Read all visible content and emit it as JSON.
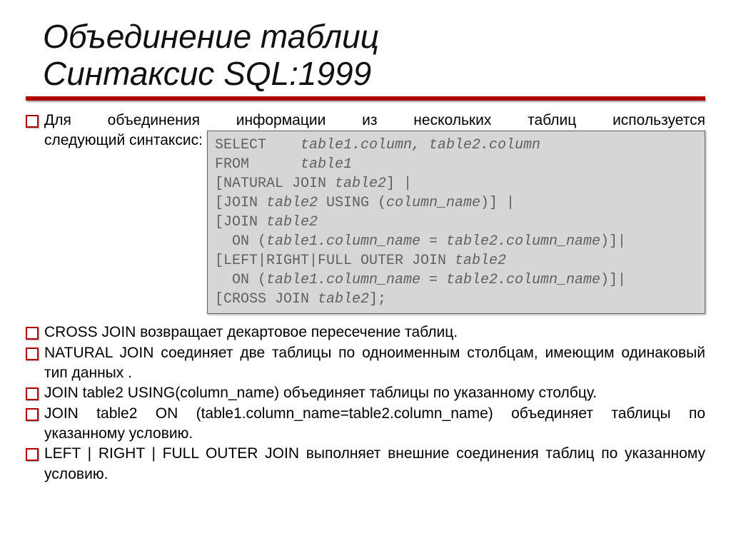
{
  "title_line1": "Объединение таблиц",
  "title_line2": "Синтаксис SQL:1999",
  "intro_top": "Для объединения информации из нескольких таблиц используется",
  "intro_bottom": "следующий синтаксис:",
  "code": {
    "l1a": "SELECT    ",
    "l1b": "table1.column, table2.column",
    "l2a": "FROM      ",
    "l2b": "table1",
    "l3a": "[NATURAL JOIN ",
    "l3b": "table2",
    "l3c": "] |",
    "l4a": "[JOIN ",
    "l4b": "table2",
    "l4c": " USING (",
    "l4d": "column_name",
    "l4e": ")] |",
    "l5a": "[JOIN ",
    "l5b": "table2",
    "l6a": "  ON (",
    "l6b": "table1.column_name = table2.column_name",
    "l6c": ")]|",
    "l7a": "[LEFT|RIGHT|FULL OUTER JOIN ",
    "l7b": "table2",
    "l8a": "  ON (",
    "l8b": "table1.column_name = table2.column_name",
    "l8c": ")]|",
    "l9a": "[CROSS JOIN ",
    "l9b": "table2",
    "l9c": "];"
  },
  "bullets": {
    "b1": "CROSS JOIN возвращает декартовое пересечение таблиц.",
    "b2": "NATURAL JOIN соединяет две таблицы по одноименным  столбцам, имеющим одинаковый тип данных .",
    "b3": "JOIN table2   USING(column_name) объединяет таблицы по указанному столбцу.",
    "b4": "JOIN table2 ON (table1.column_name=table2.column_name) объединяет таблицы по указанному условию.",
    "b5": "LEFT | RIGHT | FULL OUTER JOIN выполняет внешние соединения таблиц по указанному условию."
  }
}
